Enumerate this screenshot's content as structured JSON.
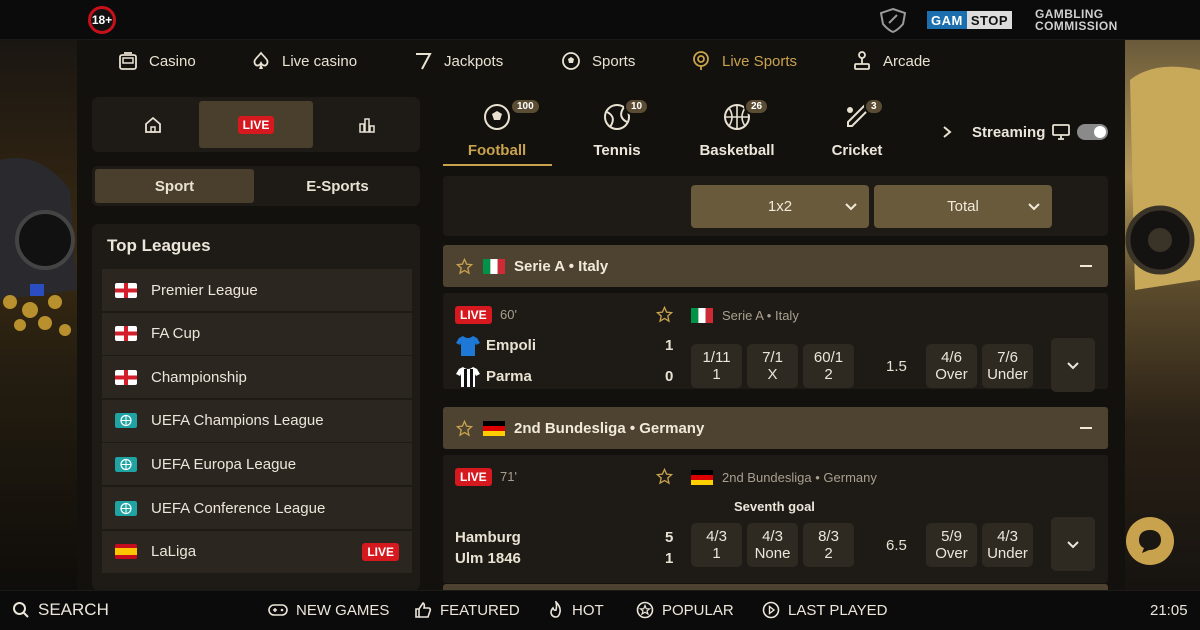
{
  "header": {
    "age_badge": "18+",
    "gamstop_gam": "GAM",
    "gamstop_stop": "STOP",
    "gambling_commission_line1": "GAMBLING",
    "gambling_commission_line2": "COMMISSION"
  },
  "nav": [
    {
      "label": "Casino",
      "icon": "casino-icon"
    },
    {
      "label": "Live casino",
      "icon": "spade-icon"
    },
    {
      "label": "Jackpots",
      "icon": "seven-icon"
    },
    {
      "label": "Sports",
      "icon": "football-icon"
    },
    {
      "label": "Live Sports",
      "icon": "live-target-icon",
      "active": true
    },
    {
      "label": "Arcade",
      "icon": "joystick-icon"
    }
  ],
  "quick": {
    "live_label": "LIVE"
  },
  "sport_tabs": [
    "Sport",
    "E-Sports"
  ],
  "top_leagues": {
    "title": "Top Leagues",
    "items": [
      {
        "label": "Premier League",
        "flag": "england"
      },
      {
        "label": "FA Cup",
        "flag": "england"
      },
      {
        "label": "Championship",
        "flag": "england"
      },
      {
        "label": "UEFA Champions League",
        "flag": "world"
      },
      {
        "label": "UEFA Europa League",
        "flag": "world"
      },
      {
        "label": "UEFA Conference League",
        "flag": "world"
      },
      {
        "label": "LaLiga",
        "flag": "spain",
        "live": "LIVE"
      }
    ]
  },
  "sports": [
    {
      "name": "Football",
      "count": "100",
      "icon": "soccer-ball-icon",
      "active": true
    },
    {
      "name": "Tennis",
      "count": "10",
      "icon": "tennis-ball-icon"
    },
    {
      "name": "Basketball",
      "count": "26",
      "icon": "basketball-icon"
    },
    {
      "name": "Cricket",
      "count": "3",
      "icon": "cricket-icon"
    }
  ],
  "streaming": {
    "label": "Streaming",
    "enabled": false
  },
  "markets": {
    "primary": "1x2",
    "secondary": "Total"
  },
  "leagues": [
    {
      "header": "Serie A • Italy",
      "flag": "italy",
      "match": {
        "live": "LIVE",
        "minute": "60'",
        "league": "Serie A • Italy",
        "home": "Empoli",
        "away": "Parma",
        "home_score": "1",
        "away_score": "0",
        "odds": [
          {
            "v": "1/11",
            "l": "1"
          },
          {
            "v": "7/1",
            "l": "X"
          },
          {
            "v": "60/1",
            "l": "2"
          }
        ],
        "line": "1.5",
        "totals": [
          {
            "v": "4/6",
            "l": "Over"
          },
          {
            "v": "7/6",
            "l": "Under"
          }
        ]
      }
    },
    {
      "header": "2nd Bundesliga • Germany",
      "flag": "germany",
      "match": {
        "live": "LIVE",
        "minute": "71'",
        "league": "2nd Bundesliga • Germany",
        "note": "Seventh goal",
        "home": "Hamburg",
        "away": "Ulm 1846",
        "home_score": "5",
        "away_score": "1",
        "odds": [
          {
            "v": "4/3",
            "l": "1"
          },
          {
            "v": "4/3",
            "l": "None"
          },
          {
            "v": "8/3",
            "l": "2"
          }
        ],
        "line": "6.5",
        "totals": [
          {
            "v": "5/9",
            "l": "Over"
          },
          {
            "v": "4/3",
            "l": "Under"
          }
        ]
      }
    }
  ],
  "bottom": {
    "search": "SEARCH",
    "items": [
      "NEW GAMES",
      "FEATURED",
      "HOT",
      "POPULAR",
      "LAST PLAYED"
    ],
    "clock": "21:05"
  },
  "colors": {
    "accent": "#c9a24e",
    "live": "#d5191f",
    "panel": "#1e1b16"
  }
}
